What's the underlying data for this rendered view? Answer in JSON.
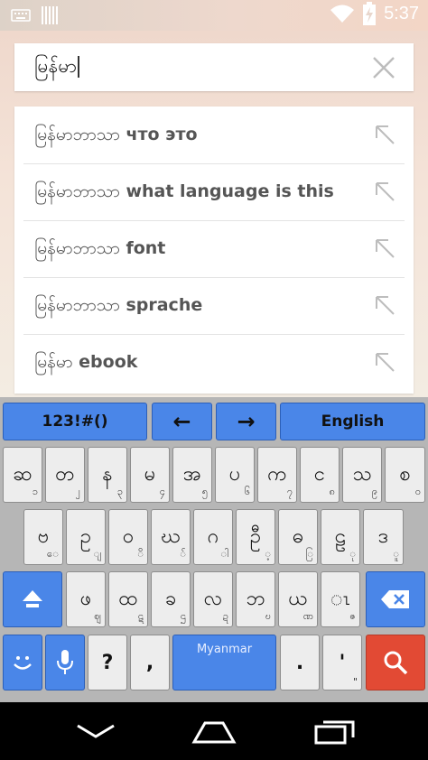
{
  "status": {
    "time": "5:37"
  },
  "search": {
    "query": "မြန်မာ"
  },
  "suggestions": [
    {
      "prefix": "မြန်မာဘာသာ",
      "rest": " что это"
    },
    {
      "prefix": "မြန်မာဘာသာ",
      "rest": " what language is this"
    },
    {
      "prefix": "မြန်မာဘာသာ",
      "rest": " font"
    },
    {
      "prefix": "မြန်မာဘာသာ",
      "rest": " sprache"
    },
    {
      "prefix": "မြန်မာ",
      "rest": " ebook"
    }
  ],
  "keyboard": {
    "top_row": {
      "symbols": "123!#()",
      "left_arrow": "←",
      "right_arrow": "→",
      "language": "English"
    },
    "row1": [
      {
        "main": "ဆ",
        "sub": "၁"
      },
      {
        "main": "တ",
        "sub": "၂"
      },
      {
        "main": "န",
        "sub": "၃"
      },
      {
        "main": "မ",
        "sub": "၄"
      },
      {
        "main": "အ",
        "sub": "၅"
      },
      {
        "main": "ပ",
        "sub": "၆"
      },
      {
        "main": "က",
        "sub": "၇"
      },
      {
        "main": "င",
        "sub": "၈"
      },
      {
        "main": "သ",
        "sub": "၉"
      },
      {
        "main": "စ",
        "sub": "၀"
      }
    ],
    "row2": [
      {
        "main": "ဗ",
        "sub": "ေ"
      },
      {
        "main": "ဥ",
        "sub": "ျ"
      },
      {
        "main": "ဝ",
        "sub": "ိ"
      },
      {
        "main": "ဃ",
        "sub": "်"
      },
      {
        "main": "ဂ",
        "sub": "ါ"
      },
      {
        "main": "ဦ",
        "sub": "့"
      },
      {
        "main": "ဓ",
        "sub": "ြ"
      },
      {
        "main": "ဠ",
        "sub": "ု"
      },
      {
        "main": "ဒ",
        "sub": "ူ"
      }
    ],
    "row3": [
      {
        "main": "ဖ",
        "sub": "ဈ"
      },
      {
        "main": "ထ",
        "sub": "ဋ"
      },
      {
        "main": "ခ",
        "sub": "ဌ"
      },
      {
        "main": "လ",
        "sub": "ဍ"
      },
      {
        "main": "ဘ",
        "sub": "ဎ"
      },
      {
        "main": "ယ",
        "sub": "ဏ"
      },
      {
        "main": "ၤ",
        "sub": "ဇ"
      }
    ],
    "bottom_row": {
      "question": "?",
      "comma": ",",
      "space_label": "Myanmar",
      "period": ".",
      "apostrophe": "'",
      "apostrophe_sub": "\""
    }
  },
  "colors": {
    "key_blue": "#4a86e8",
    "key_gray": "#ededed",
    "key_red": "#e24a34",
    "keyboard_bg": "#b6b6b6"
  }
}
